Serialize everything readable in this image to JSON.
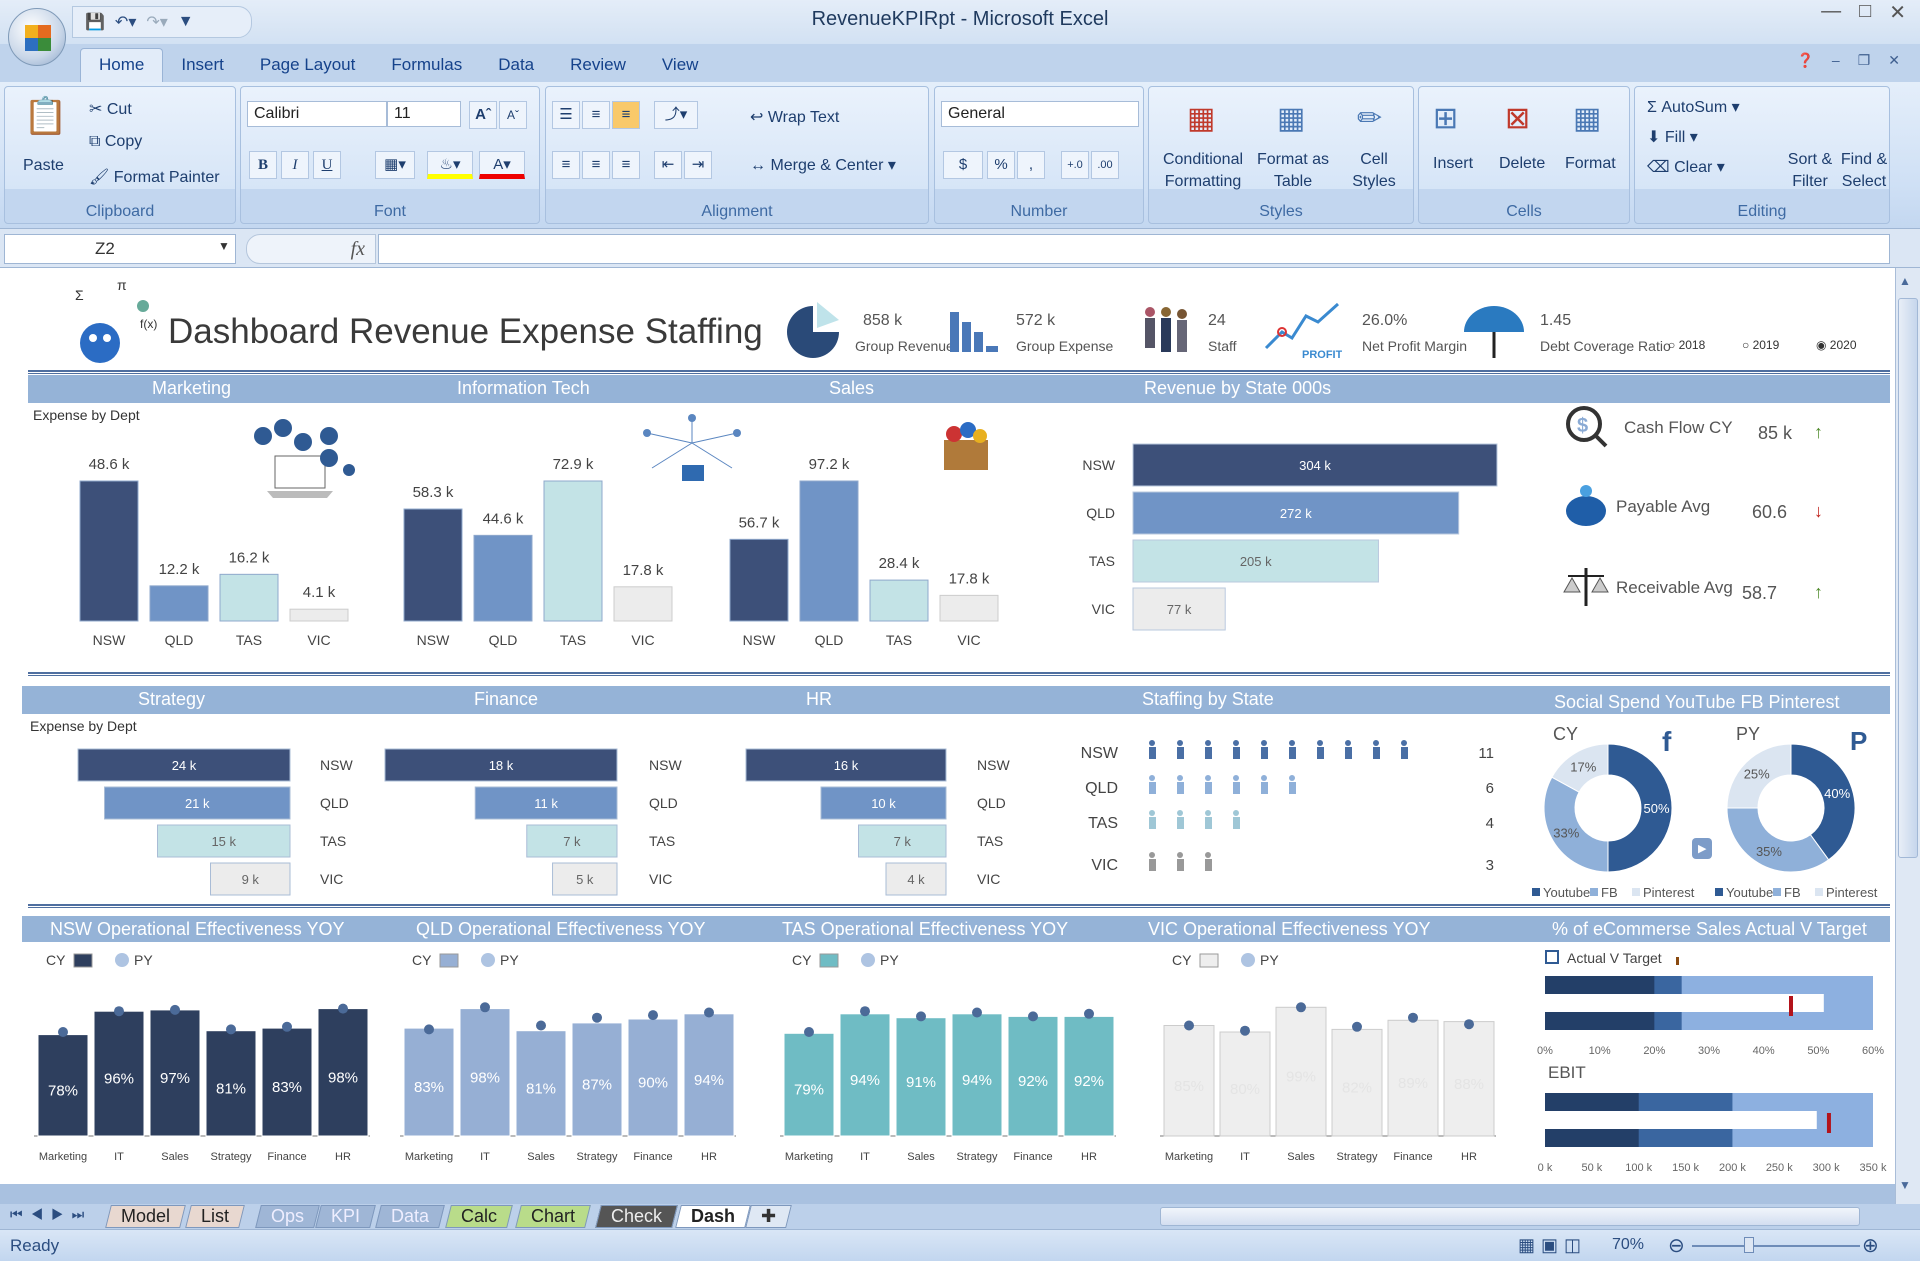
{
  "window": {
    "title": "RevenueKPIRpt - Microsoft Excel"
  },
  "ribbon": {
    "tabs": [
      "Home",
      "Insert",
      "Page Layout",
      "Formulas",
      "Data",
      "Review",
      "View"
    ],
    "active_tab": "Home",
    "clipboard": {
      "paste": "Paste",
      "cut": "Cut",
      "copy": "Copy",
      "format_painter": "Format Painter",
      "label": "Clipboard"
    },
    "font": {
      "name": "Calibri",
      "size": "11",
      "bold": "B",
      "italic": "I",
      "underline": "U",
      "label": "Font",
      "fill_color": "#ffff00",
      "font_color": "#e00000"
    },
    "alignment": {
      "wrap": "Wrap Text",
      "merge": "Merge & Center",
      "label": "Alignment"
    },
    "number": {
      "format": "General",
      "currency": "$",
      "percent": "%",
      "comma": ",",
      "label": "Number"
    },
    "styles": {
      "conditional": "Conditional Formatting",
      "format_table": "Format as Table",
      "cell_styles": "Cell Styles",
      "label": "Styles"
    },
    "cells": {
      "insert": "Insert",
      "delete": "Delete",
      "format": "Format",
      "label": "Cells"
    },
    "editing": {
      "autosum": "AutoSum",
      "fill": "Fill",
      "clear": "Clear",
      "sort": "Sort & Filter",
      "find": "Find & Select",
      "label": "Editing"
    }
  },
  "formula_bar": {
    "name_box": "Z2",
    "fx": "fx",
    "value": ""
  },
  "dashboard": {
    "title": "Dashboard Revenue Expense Staffing",
    "kpis": [
      {
        "value": "858 k",
        "label": "Group Revenue",
        "icon": "pie-chart-icon"
      },
      {
        "value": "572 k",
        "label": "Group Expense",
        "icon": "bar-chart-icon"
      },
      {
        "value": "24",
        "label": "Staff",
        "icon": "people-icon"
      },
      {
        "value": "26.0%",
        "label": "Net Profit Margin",
        "icon": "profit-graph-icon"
      },
      {
        "value": "1.45",
        "label": "Debt Coverage Ratio",
        "icon": "umbrella-icon"
      }
    ],
    "year_options": [
      "2018",
      "2019",
      "2020"
    ],
    "selected_year": "2020",
    "band1": [
      "Marketing",
      "Information Tech",
      "Sales",
      "Revenue by State 000s"
    ],
    "band2": [
      "Strategy",
      "Finance",
      "HR",
      "Staffing by State",
      "Social Spend YouTube FB Pinterest"
    ],
    "band3": [
      "NSW Operational Effectiveness YOY",
      "QLD Operational Effectiveness YOY",
      "TAS Operational Effectiveness YOY",
      "VIC Operational Effectiveness YOY",
      "% of eCommerse Sales Actual V Target"
    ],
    "expense_by_dept": "Expense by Dept",
    "side_kpis": [
      {
        "label": "Cash Flow CY",
        "value": "85 k",
        "trend": "up",
        "icon": "cash-search-icon"
      },
      {
        "label": "Payable Avg",
        "value": "60.6",
        "trend": "down",
        "icon": "piggy-bank-icon"
      },
      {
        "label": "Receivable Avg",
        "value": "58.7",
        "trend": "up",
        "icon": "scales-icon"
      }
    ],
    "colors": {
      "NSW": "#3d5079",
      "QLD": "#7094c6",
      "TAS": "#c3e3e6",
      "VIC": "#ececec",
      "band": "#95b3d7",
      "up": "#4f8a2a",
      "down": "#c0201a"
    }
  },
  "chart_data": [
    {
      "type": "bar",
      "title": "Marketing",
      "categories": [
        "NSW",
        "QLD",
        "TAS",
        "VIC"
      ],
      "values": [
        48.6,
        12.2,
        16.2,
        4.1
      ],
      "labels": [
        "48.6 k",
        "12.2 k",
        "16.2 k",
        "4.1 k"
      ]
    },
    {
      "type": "bar",
      "title": "Information Tech",
      "categories": [
        "NSW",
        "QLD",
        "TAS",
        "VIC"
      ],
      "values": [
        58.3,
        44.6,
        72.9,
        17.8
      ],
      "labels": [
        "58.3 k",
        "44.6 k",
        "72.9 k",
        "17.8 k"
      ]
    },
    {
      "type": "bar",
      "title": "Sales",
      "categories": [
        "NSW",
        "QLD",
        "TAS",
        "VIC"
      ],
      "values": [
        56.7,
        97.2,
        28.4,
        17.8
      ],
      "labels": [
        "56.7 k",
        "97.2 k",
        "28.4 k",
        "17.8 k"
      ]
    },
    {
      "type": "bar",
      "orientation": "horizontal",
      "title": "Revenue by State 000s",
      "categories": [
        "NSW",
        "QLD",
        "TAS",
        "VIC"
      ],
      "values": [
        304,
        272,
        205,
        77
      ],
      "labels": [
        "304 k",
        "272 k",
        "205 k",
        "77 k"
      ]
    },
    {
      "type": "bar",
      "orientation": "horizontal",
      "title": "Strategy",
      "categories": [
        "NSW",
        "QLD",
        "TAS",
        "VIC"
      ],
      "values": [
        24,
        21,
        15,
        9
      ],
      "labels": [
        "24 k",
        "21 k",
        "15 k",
        "9 k"
      ]
    },
    {
      "type": "bar",
      "orientation": "horizontal",
      "title": "Finance",
      "categories": [
        "NSW",
        "QLD",
        "TAS",
        "VIC"
      ],
      "values": [
        18,
        11,
        7,
        5
      ],
      "labels": [
        "18 k",
        "11 k",
        "7 k",
        "5 k"
      ]
    },
    {
      "type": "bar",
      "orientation": "horizontal",
      "title": "HR",
      "categories": [
        "NSW",
        "QLD",
        "TAS",
        "VIC"
      ],
      "values": [
        16,
        10,
        7,
        4
      ],
      "labels": [
        "16 k",
        "10 k",
        "7 k",
        "4 k"
      ]
    },
    {
      "type": "table",
      "title": "Staffing by State",
      "categories": [
        "NSW",
        "QLD",
        "TAS",
        "VIC"
      ],
      "values": [
        11,
        6,
        4,
        3
      ]
    },
    {
      "type": "pie",
      "title": "CY",
      "donut": true,
      "categories": [
        "Youtube",
        "FB",
        "Pinterest"
      ],
      "values": [
        50,
        33,
        17
      ],
      "colors": [
        "#2f5a93",
        "#8fb0d9",
        "#dbe5f1"
      ]
    },
    {
      "type": "pie",
      "title": "PY",
      "donut": true,
      "categories": [
        "Youtube",
        "FB",
        "Pinterest"
      ],
      "values": [
        40,
        35,
        25
      ],
      "colors": [
        "#2f5a93",
        "#8fb0d9",
        "#dbe5f1"
      ]
    },
    {
      "type": "bar",
      "title": "NSW Operational Effectiveness YOY",
      "categories": [
        "Marketing",
        "IT",
        "Sales",
        "Strategy",
        "Finance",
        "HR"
      ],
      "series": [
        {
          "name": "CY",
          "values": [
            78,
            96,
            97,
            81,
            83,
            98
          ]
        },
        {
          "name": "PY",
          "values": [
            80,
            96,
            97,
            82,
            84,
            98
          ]
        }
      ],
      "color": "#2e3f5e"
    },
    {
      "type": "bar",
      "title": "QLD Operational Effectiveness YOY",
      "categories": [
        "Marketing",
        "IT",
        "Sales",
        "Strategy",
        "Finance",
        "HR"
      ],
      "series": [
        {
          "name": "CY",
          "values": [
            83,
            98,
            81,
            87,
            90,
            94
          ]
        },
        {
          "name": "PY",
          "values": [
            82,
            99,
            85,
            91,
            93,
            95
          ]
        }
      ],
      "color": "#96afd4"
    },
    {
      "type": "bar",
      "title": "TAS Operational Effectiveness YOY",
      "categories": [
        "Marketing",
        "IT",
        "Sales",
        "Strategy",
        "Finance",
        "HR"
      ],
      "series": [
        {
          "name": "CY",
          "values": [
            79,
            94,
            91,
            94,
            92,
            92
          ]
        },
        {
          "name": "PY",
          "values": [
            80,
            96,
            92,
            95,
            92,
            94
          ]
        }
      ],
      "color": "#6fbcc4"
    },
    {
      "type": "bar",
      "title": "VIC Operational Effectiveness YOY",
      "categories": [
        "Marketing",
        "IT",
        "Sales",
        "Strategy",
        "Finance",
        "HR"
      ],
      "series": [
        {
          "name": "CY",
          "values": [
            85,
            80,
            99,
            82,
            89,
            88
          ]
        },
        {
          "name": "PY",
          "values": [
            85,
            81,
            99,
            84,
            91,
            86
          ]
        }
      ],
      "color": "#eeeeee"
    },
    {
      "type": "bullet",
      "title": "Actual V Target",
      "ticks": [
        "0%",
        "10%",
        "20%",
        "30%",
        "40%",
        "50%",
        "60%"
      ],
      "xlim": [
        0,
        60
      ],
      "bands": [
        20,
        25,
        60
      ],
      "actual": 51,
      "target": 45
    },
    {
      "type": "bullet",
      "title": "EBIT",
      "ticks": [
        "0 k",
        "50 k",
        "100 k",
        "150 k",
        "200 k",
        "250 k",
        "300 k",
        "350 k"
      ],
      "xlim": [
        0,
        350
      ],
      "bands": [
        100,
        200,
        350
      ],
      "actual": 290,
      "target": 303
    }
  ],
  "sheet_tabs": [
    "Model",
    "List",
    "Ops",
    "KPI",
    "Data",
    "Calc",
    "Chart",
    "Check",
    "Dash"
  ],
  "active_sheet": "Dash",
  "status": {
    "ready": "Ready",
    "zoom": "70%"
  }
}
